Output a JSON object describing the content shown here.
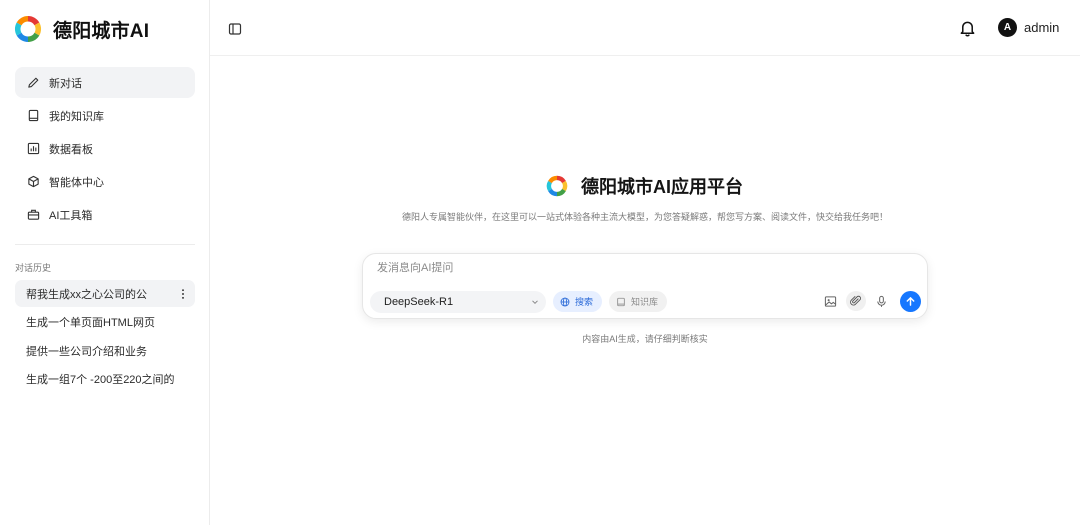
{
  "brand": {
    "name": "德阳城市AI",
    "logo_icon": "sun-logo-icon"
  },
  "nav": {
    "items": [
      {
        "label": "新对话",
        "icon": "pencil-icon",
        "active": true
      },
      {
        "label": "我的知识库",
        "icon": "book-icon",
        "active": false
      },
      {
        "label": "数据看板",
        "icon": "bar-chart-icon",
        "active": false
      },
      {
        "label": "智能体中心",
        "icon": "cube-icon",
        "active": false
      },
      {
        "label": "AI工具箱",
        "icon": "toolbox-icon",
        "active": false
      }
    ]
  },
  "history": {
    "title": "对话历史",
    "items": [
      {
        "label": "帮我生成xx之心公司的公",
        "active": true
      },
      {
        "label": "生成一个单页面HTML网页",
        "active": false
      },
      {
        "label": "提供一些公司介绍和业务",
        "active": false
      },
      {
        "label": "生成一组7个 -200至220之间的",
        "active": false
      }
    ]
  },
  "header": {
    "user": {
      "initial": "A",
      "name": "admin"
    }
  },
  "main": {
    "title": "德阳城市AI应用平台",
    "subtitle": "德阳人专属智能伙伴，在这里可以一站式体验各种主流大模型，为您答疑解惑，帮您写方案、阅读文件，快交给我任务吧！",
    "input_placeholder": "发消息向AI提问",
    "model": "DeepSeek-R1",
    "search_label": "搜索",
    "kb_label": "知识库",
    "footnote": "内容由AI生成，请仔细判断核实"
  },
  "colors": {
    "accent": "#1677ff",
    "search_pill_bg": "#e7efff",
    "search_pill_text": "#2b6ad8"
  }
}
